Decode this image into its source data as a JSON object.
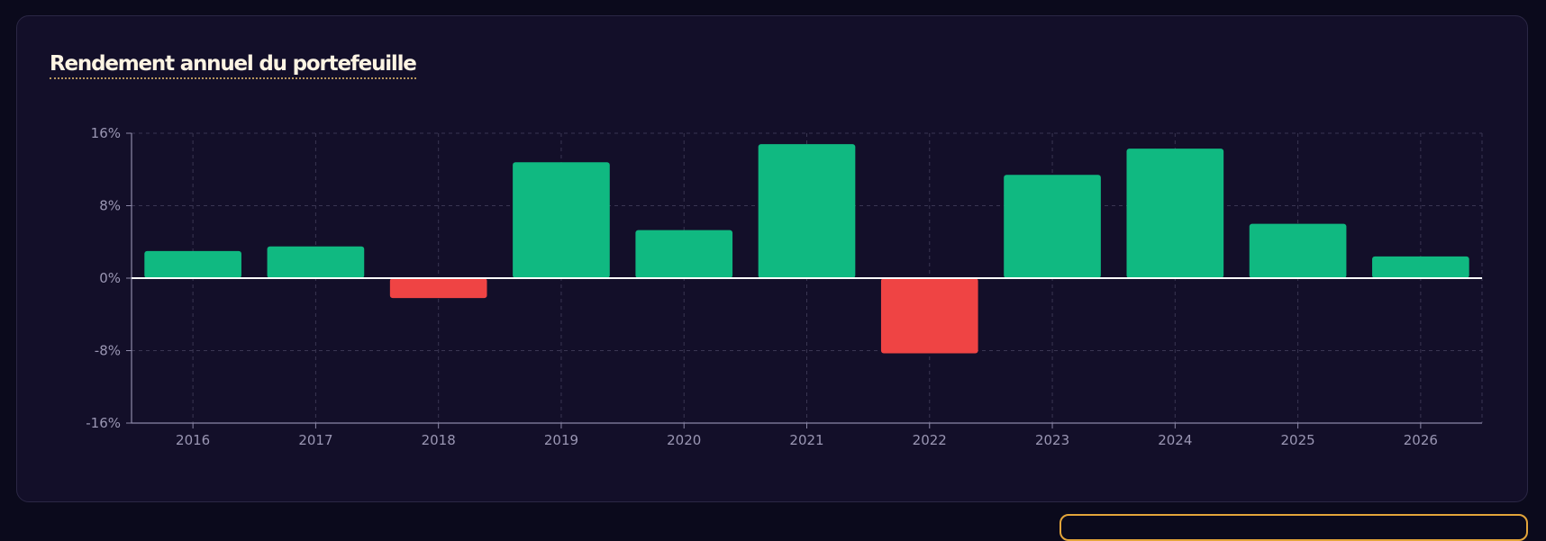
{
  "panel": {
    "title": "Rendement annuel du portefeuille"
  },
  "chart_data": {
    "type": "bar",
    "title": "Rendement annuel du portefeuille",
    "xlabel": "",
    "ylabel": "",
    "categories": [
      "2016",
      "2017",
      "2018",
      "2019",
      "2020",
      "2021",
      "2022",
      "2023",
      "2024",
      "2025",
      "2026"
    ],
    "values": [
      3.0,
      3.5,
      -2.2,
      12.8,
      5.3,
      14.8,
      -8.3,
      11.4,
      14.3,
      6.0,
      2.4
    ],
    "ylim": [
      -16,
      16
    ],
    "yticks": [
      16,
      8,
      0,
      -8,
      -16
    ],
    "ytick_labels": [
      "16%",
      "8%",
      "0%",
      "-8%",
      "-16%"
    ],
    "grid": true,
    "legend": "none",
    "colors": {
      "positive": "#10b981",
      "negative": "#ef4444",
      "zero_line": "#ffffff",
      "grid": "#3a3652",
      "axis": "#8c88a8",
      "tick_text": "#9a96b3"
    }
  }
}
